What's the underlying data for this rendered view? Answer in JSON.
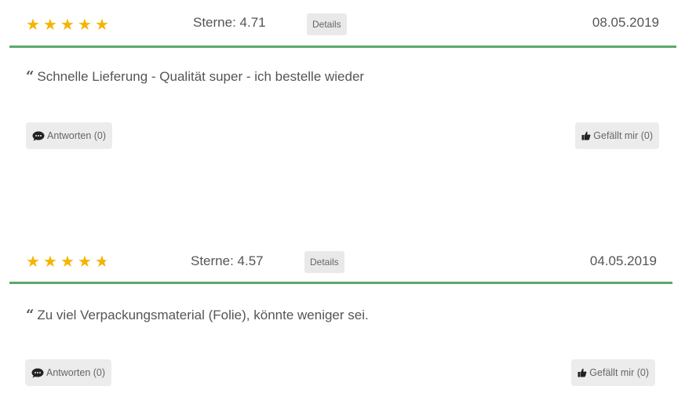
{
  "reviews": [
    {
      "rating": 4.71,
      "score_label": "Sterne: 4.71",
      "details_label": "Details",
      "date": "08.05.2019",
      "text": "Schnelle Lieferung - Qualität super - ich bestelle wieder",
      "reply_label": "Antworten (0)",
      "like_label": "Gefällt mir (0)"
    },
    {
      "rating": 4.57,
      "score_label": "Sterne: 4.57",
      "details_label": "Details",
      "date": "04.05.2019",
      "text": "Zu viel Verpackungsmaterial (Folie), könnte weniger sei.",
      "reply_label": "Antworten (0)",
      "like_label": "Gefällt mir (0)"
    }
  ],
  "colors": {
    "star": "#f5b400",
    "divider": "#5aa96a",
    "button_bg": "#ececec"
  },
  "icons": {
    "quote": "quote-icon",
    "reply": "comment-icon",
    "like": "thumbs-up-icon"
  }
}
